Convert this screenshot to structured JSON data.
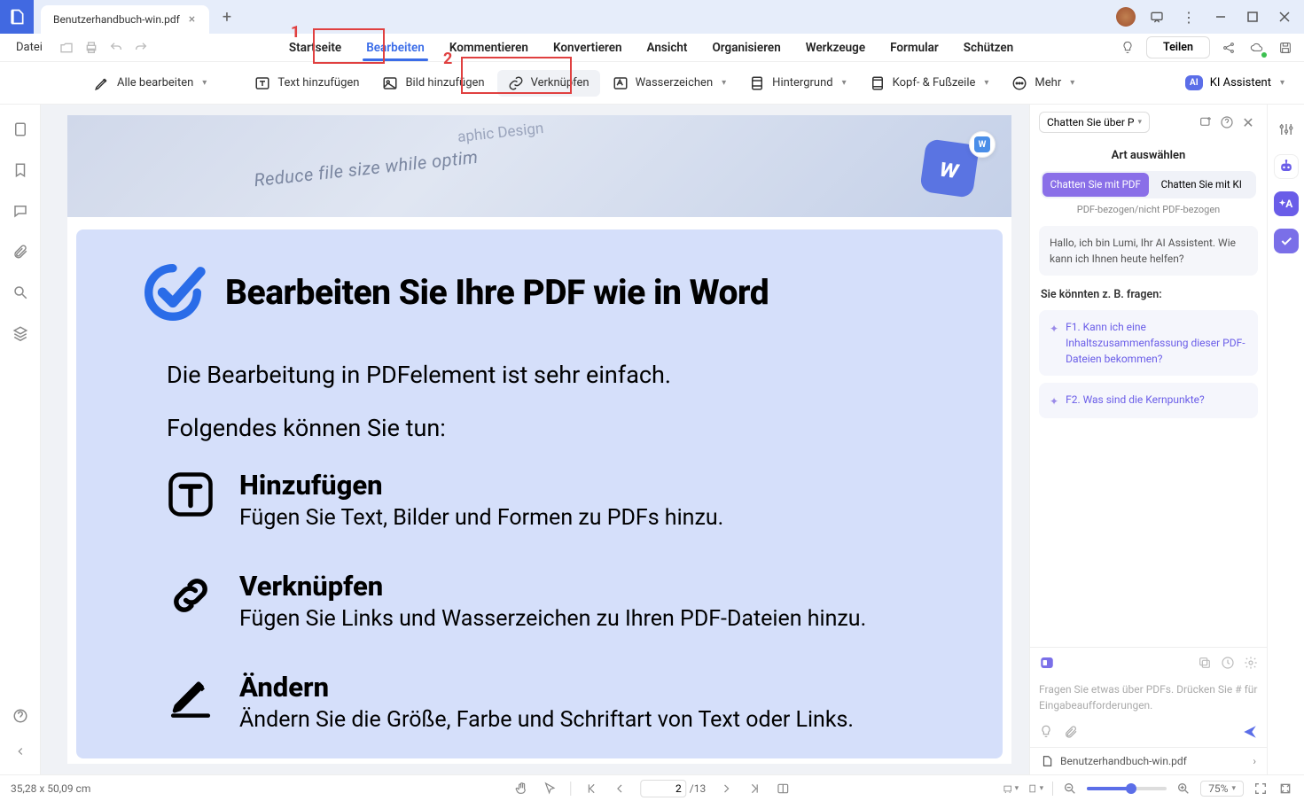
{
  "titlebar": {
    "tab_name": "Benutzerhandbuch-win.pdf"
  },
  "menubar": {
    "file": "Datei",
    "tabs": [
      "Startseite",
      "Bearbeiten",
      "Kommentieren",
      "Konvertieren",
      "Ansicht",
      "Organisieren",
      "Werkzeuge",
      "Formular",
      "Schützen"
    ],
    "active_tab_index": 1,
    "share": "Teilen"
  },
  "toolbar": {
    "edit_all": "Alle bearbeiten",
    "add_text": "Text hinzufügen",
    "add_image": "Bild hinzufügen",
    "link": "Verknüpfen",
    "watermark": "Wasserzeichen",
    "background": "Hintergrund",
    "header_footer": "Kopf- & Fußzeile",
    "more": "Mehr",
    "ai_assistant": "KI Assistent",
    "ai_badge": "AI"
  },
  "annotations": {
    "num1": "1",
    "num2": "2"
  },
  "document": {
    "hero_text1": "Reduce file size while optim",
    "hero_text2": "aphic Design",
    "word_badge": "W",
    "title": "Bearbeiten Sie Ihre PDF wie in Word",
    "lead1": "Die Bearbeitung in PDFelement ist sehr einfach.",
    "lead2": "Folgendes können Sie tun:",
    "features": [
      {
        "title": "Hinzufügen",
        "desc": "Fügen Sie Text, Bilder und Formen zu PDFs hinzu."
      },
      {
        "title": "Verknüpfen",
        "desc": "Fügen Sie Links und Wasserzeichen zu Ihren PDF-Dateien hinzu."
      },
      {
        "title": "Ändern",
        "desc": "Ändern Sie die Größe, Farbe und Schriftart von Text oder Links."
      }
    ]
  },
  "ai_panel": {
    "select_label": "Chatten Sie über P",
    "subtitle": "Art auswählen",
    "toggle1": "Chatten Sie mit PDF",
    "toggle2": "Chatten Sie mit KI",
    "caption": "PDF-bezogen/nicht PDF-bezogen",
    "greeting": "Hallo, ich bin Lumi, Ihr AI Assistent. Wie kann ich Ihnen heute helfen?",
    "suggest_title": "Sie könnten z. B. fragen:",
    "suggest1": "F1. Kann ich eine Inhaltszusammenfassung dieser PDF-Dateien bekommen?",
    "suggest2": "F2. Was sind die Kernpunkte?",
    "input_placeholder": "Fragen Sie etwas über PDFs. Drücken Sie # für Eingabeaufforderungen.",
    "footer_file": "Benutzerhandbuch-win.pdf"
  },
  "statusbar": {
    "coords": "35,28 x 50,09 cm",
    "page_current": "2",
    "page_total": "/13",
    "zoom": "75%"
  },
  "rr": {
    "a_label": "A"
  }
}
